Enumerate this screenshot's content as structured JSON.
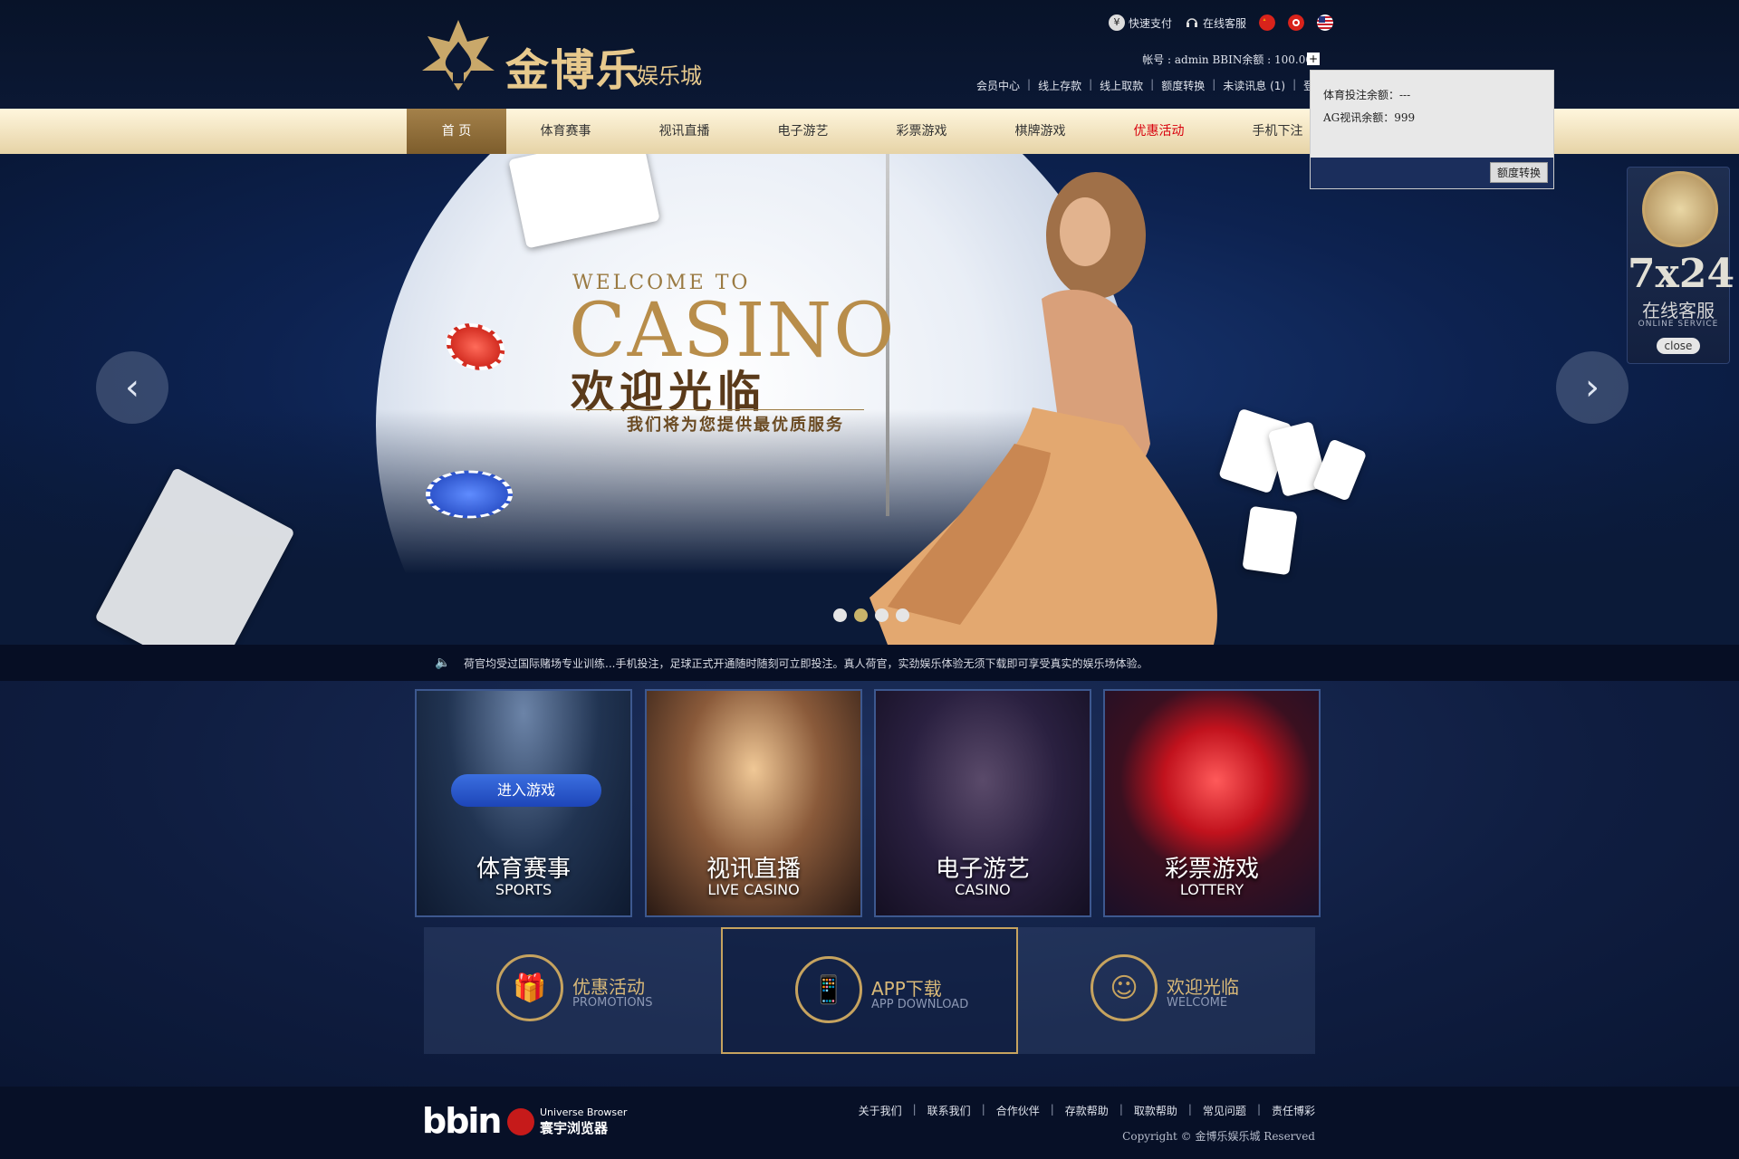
{
  "header": {
    "brand_name": "金博乐",
    "brand_sub": "娱乐城",
    "topbar": {
      "quick_pay": "快速支付",
      "online_service": "在线客服"
    },
    "account": "帐号 : admin   BBIN余额 : 100.00",
    "plus": "+",
    "user_links": [
      "会员中心",
      "线上存款",
      "线上取款",
      "额度转换",
      "未读讯息 (1)",
      "登"
    ]
  },
  "nav": {
    "items": [
      "首 页",
      "体育赛事",
      "视讯直播",
      "电子游艺",
      "彩票游戏",
      "棋牌游戏",
      "优惠活动",
      "手机下注"
    ]
  },
  "balance_dropdown": {
    "line1": "体育投注余额：---",
    "line2": "AG视讯余额：999",
    "button": "额度转换"
  },
  "banner": {
    "welcome_to": "WELCOME TO",
    "casino": "CASINO",
    "welcome_cn": "欢迎光临",
    "service": "我们将为您提供最优质服务",
    "prev": "‹",
    "next": "›",
    "dots_total": 4,
    "dots_active": 2
  },
  "side_service": {
    "hours": "7x24",
    "cn": "在线客服",
    "en": "ONLINE SERVICE",
    "close": "close"
  },
  "marquee": {
    "text": "荷官均受过国际赌场专业训练...手机投注，足球正式开通随时随刻可立即投注。真人荷官，实劲娱乐体验无须下载即可享受真实的娱乐场体验。"
  },
  "games": [
    {
      "cn": "体育赛事",
      "en": "SPORTS",
      "button": "进入游戏"
    },
    {
      "cn": "视讯直播",
      "en": "LIVE CASINO"
    },
    {
      "cn": "电子游艺",
      "en": "CASINO"
    },
    {
      "cn": "彩票游戏",
      "en": "LOTTERY"
    }
  ],
  "promos": [
    {
      "cn": "优惠活动",
      "en": "PROMOTIONS",
      "icon": "gift-icon"
    },
    {
      "cn": "APP下载",
      "en": "APP DOWNLOAD",
      "icon": "phone-icon"
    },
    {
      "cn": "欢迎光临",
      "en": "WELCOME",
      "icon": "service-agent-icon"
    }
  ],
  "footer": {
    "bbin": "bbin",
    "ub_en": "Universe Browser",
    "ub_cn": "寰宇浏览器",
    "links": [
      "关于我们",
      "联系我们",
      "合作伙伴",
      "存款帮助",
      "取款帮助",
      "常见问题",
      "责任博彩"
    ],
    "copyright": "Copyright ©  金博乐娱乐城  Reserved"
  },
  "colors": {
    "gold": "#c6a35f",
    "nav_active": "#8a6a38",
    "hot": "#d8000c",
    "bg": "#0a1633"
  }
}
